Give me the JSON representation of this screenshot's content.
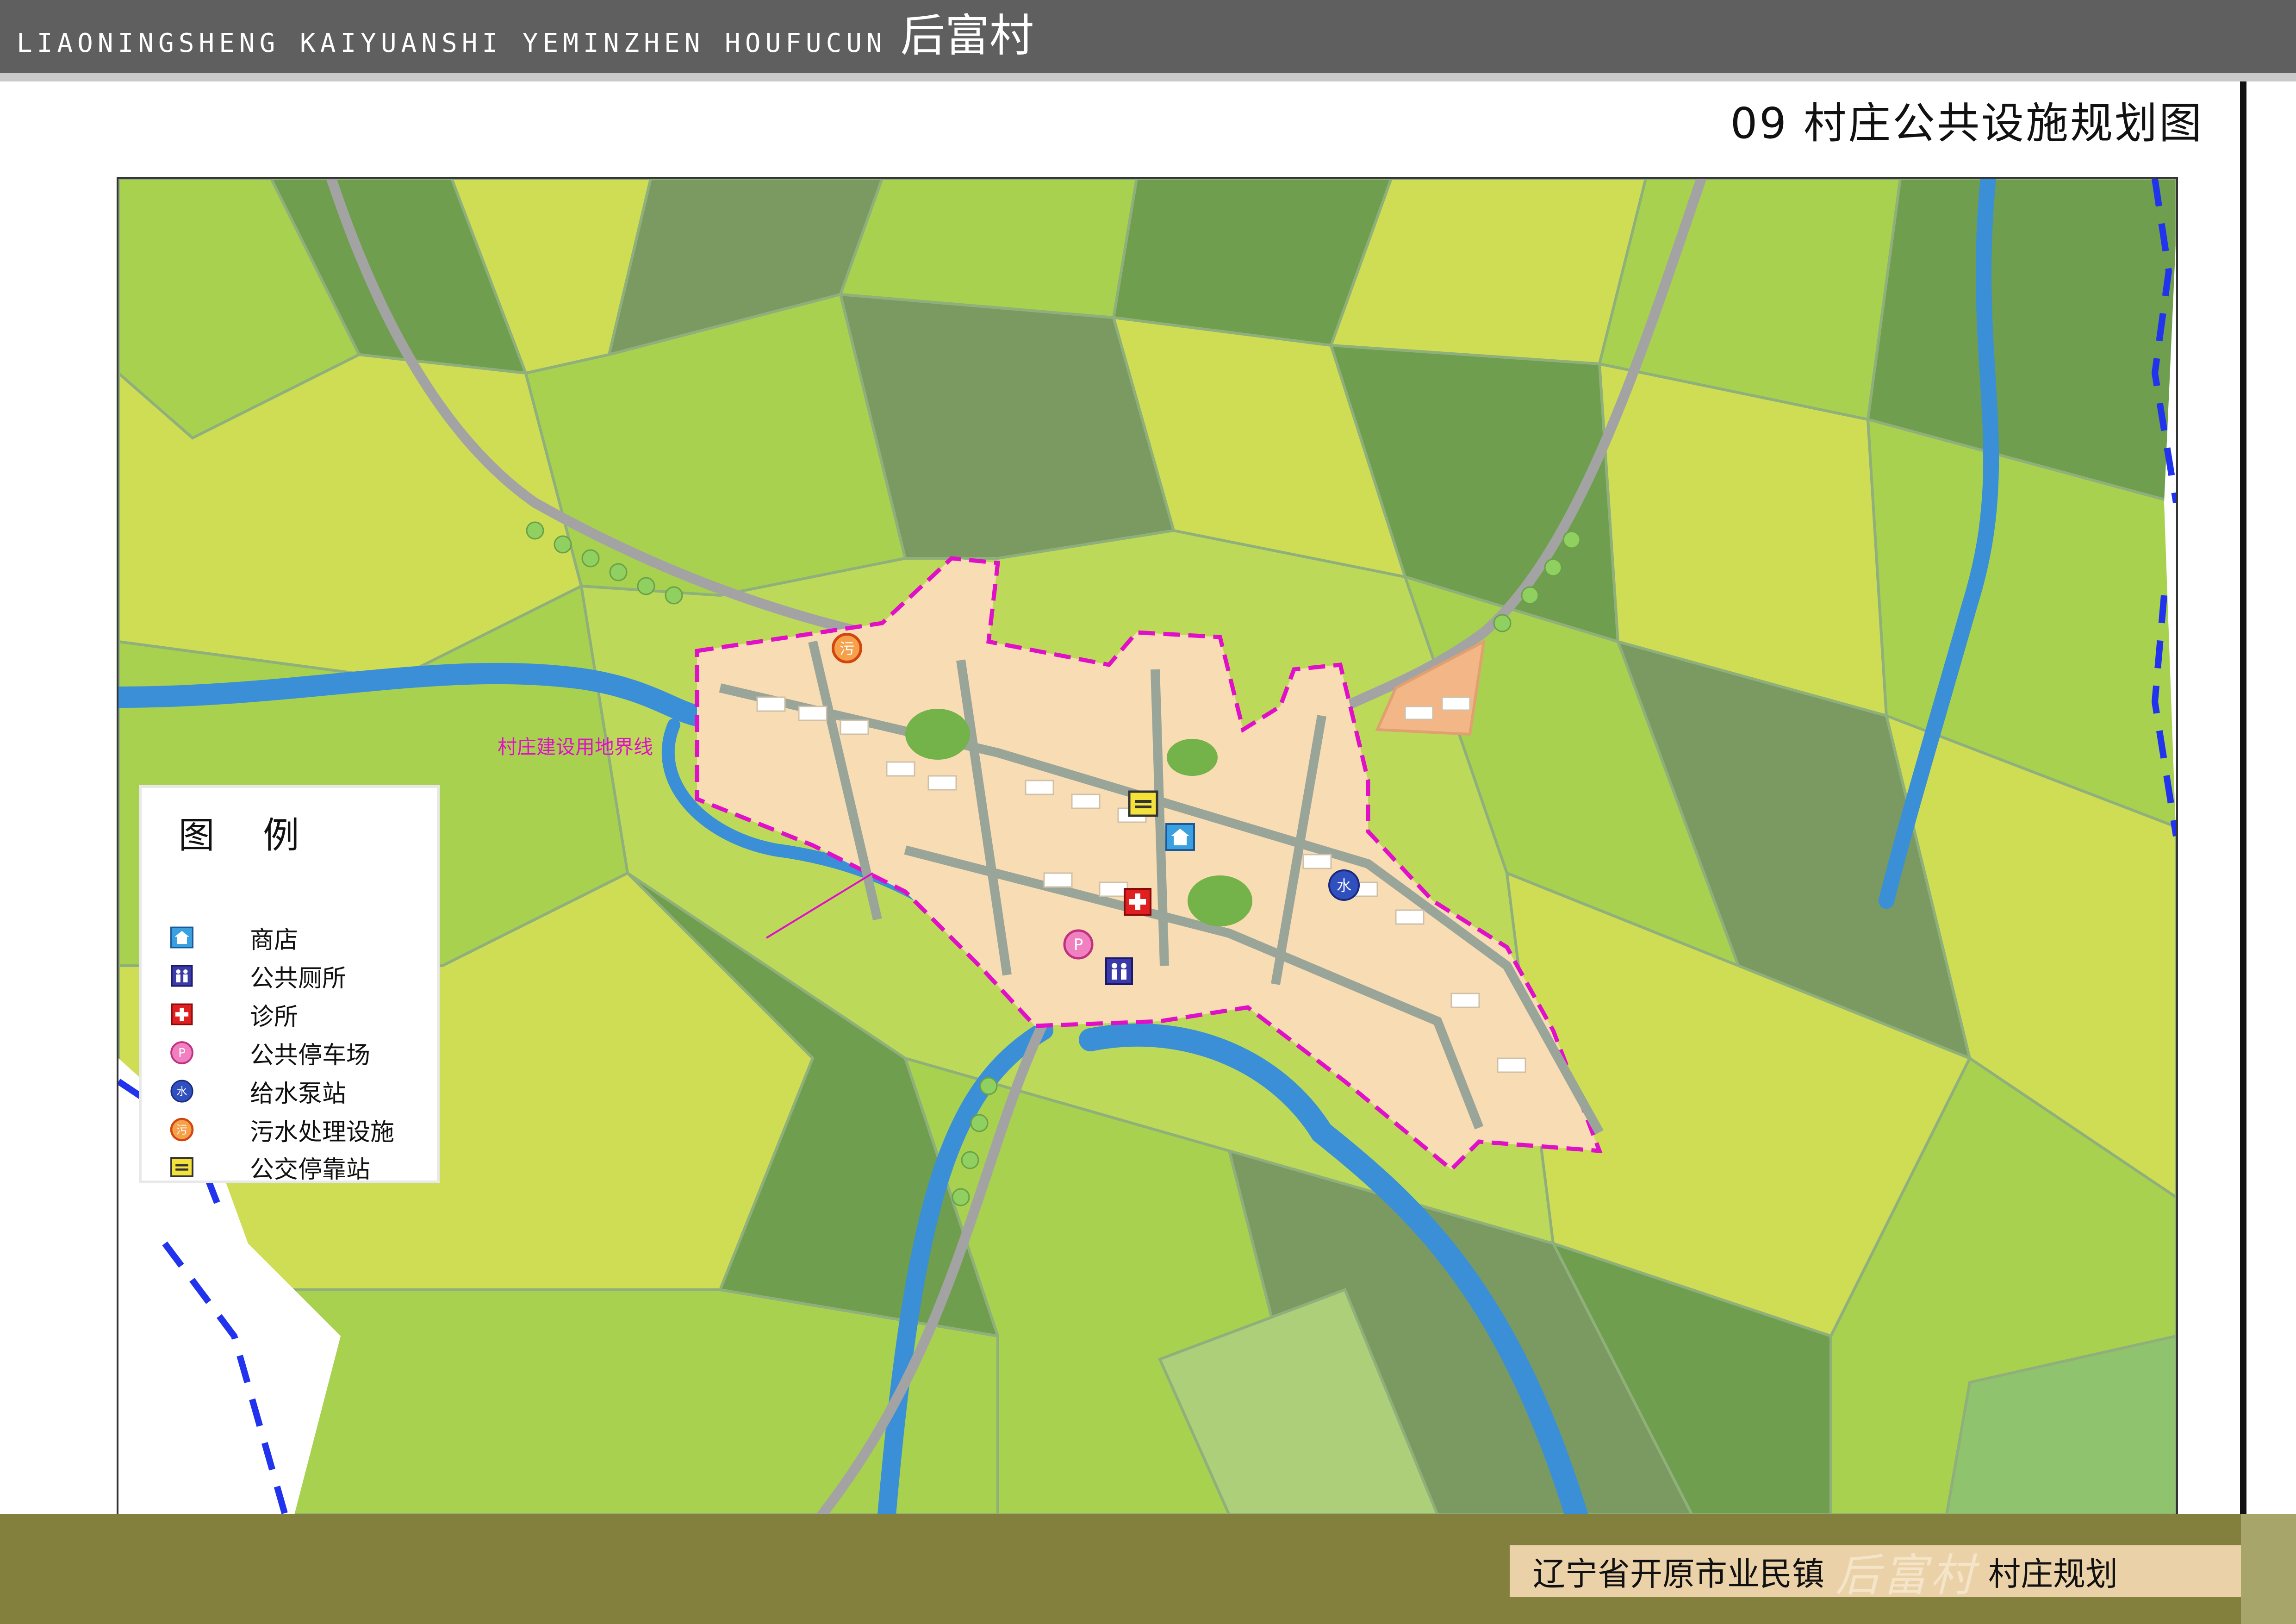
{
  "header": {
    "latin_title": "LIAONINGSHENG KAIYUANSHI YEMINZHEN HOUFUCUN",
    "cn_title": "后富村"
  },
  "sheet": {
    "title": "09 村庄公共设施规划图"
  },
  "map": {
    "boundary_label": "村庄建设用地界线",
    "colors": {
      "field_light": "#cfdd55",
      "field_mid": "#a9d150",
      "field_dark": "#6e9e4e",
      "field_olive": "#7a9a62",
      "river": "#3a8fd6",
      "road": "#a3a3a3",
      "village": "#f7dcb4",
      "boundary": "#e010c8",
      "admin_boundary": "#2233ee"
    },
    "facilities": [
      {
        "type": "sewage",
        "icon": "sewage-treatment-icon"
      },
      {
        "type": "bus",
        "icon": "bus-stop-icon"
      },
      {
        "type": "shop",
        "icon": "shop-icon"
      },
      {
        "type": "water",
        "icon": "water-pump-icon"
      },
      {
        "type": "clinic",
        "icon": "clinic-icon"
      },
      {
        "type": "parking",
        "icon": "parking-icon"
      },
      {
        "type": "toilet",
        "icon": "toilet-icon"
      }
    ]
  },
  "legend": {
    "title": "图 例",
    "items": [
      {
        "label": "商店",
        "icon": "shop-icon"
      },
      {
        "label": "公共厕所",
        "icon": "toilet-icon"
      },
      {
        "label": "诊所",
        "icon": "clinic-icon"
      },
      {
        "label": "公共停车场",
        "icon": "parking-icon"
      },
      {
        "label": "给水泵站",
        "icon": "water-pump-icon"
      },
      {
        "label": "污水处理设施",
        "icon": "sewage-treatment-icon"
      },
      {
        "label": "公交停靠站",
        "icon": "bus-stop-icon"
      }
    ]
  },
  "footer": {
    "prefix": "辽宁省开原市业民镇",
    "village": "后富村",
    "suffix": "村庄规划"
  }
}
